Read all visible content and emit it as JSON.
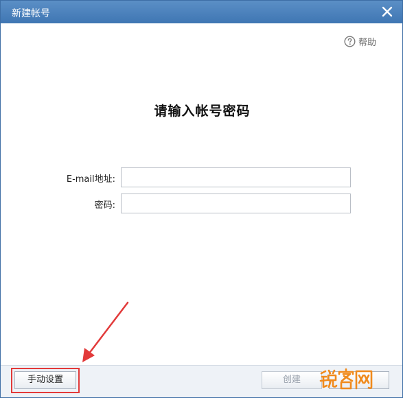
{
  "window": {
    "title": "新建帐号",
    "close_icon": "close-icon"
  },
  "help": {
    "icon": "question-circle-icon",
    "label": "帮助"
  },
  "main": {
    "heading": "请输入帐号密码",
    "fields": [
      {
        "label": "E-mail地址:",
        "value": "",
        "placeholder": ""
      },
      {
        "label": "密码:",
        "value": "",
        "placeholder": ""
      }
    ]
  },
  "footer": {
    "manual_setup_label": "手动设置",
    "create_label": "创建",
    "cancel_label": ""
  },
  "annotation": {
    "color": "#e23a3a"
  },
  "watermark": {
    "text": "锐客网",
    "color": "#f08a1c"
  },
  "colors": {
    "titlebar": "#4a82bd",
    "footer": "#eef2f7"
  }
}
